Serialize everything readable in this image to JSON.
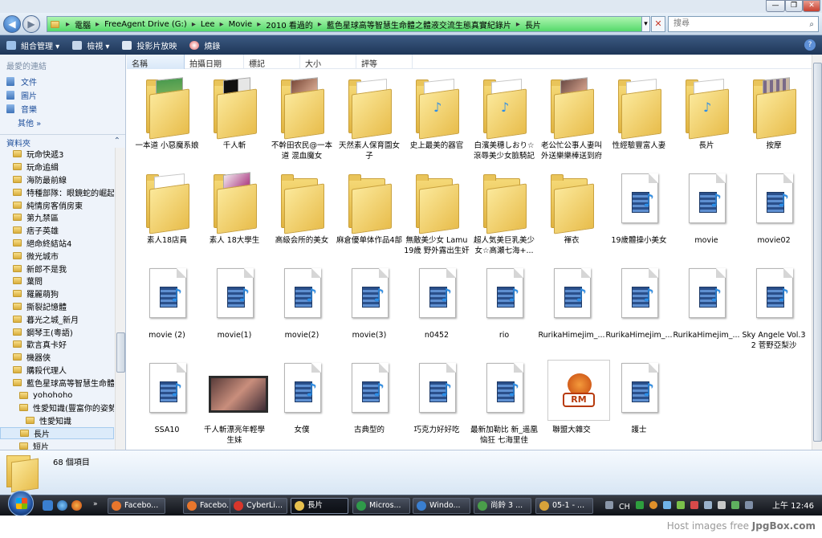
{
  "window": {
    "minimize": "—",
    "maximize": "❐",
    "close": "✕"
  },
  "address": {
    "segments": [
      "電腦",
      "FreeAgent Drive (G:)",
      "Lee",
      "Movie",
      "2010 看過的",
      "藍色星球高等智慧生命體之體液交流生態真實紀錄片",
      "長片"
    ],
    "separator": "▸",
    "dropdown": "▾",
    "stop": "✕",
    "search_placeholder": "搜尋"
  },
  "nav": {
    "back": "◀",
    "forward": "▶"
  },
  "toolbar": {
    "organize": "組合管理 ▾",
    "views": "檢視 ▾",
    "slideshow": "投影片放映",
    "burn": "燒錄",
    "help": "?"
  },
  "favorites": {
    "header": "最愛的連結",
    "items": [
      "文件",
      "圖片",
      "音樂"
    ],
    "more": "其他  »"
  },
  "folders_header": "資料夾",
  "folders_chevron": "⌃",
  "tree": [
    {
      "label": "玩命快遞3",
      "indent": 0
    },
    {
      "label": "玩命追緝",
      "indent": 0
    },
    {
      "label": "海防最前線",
      "indent": 0
    },
    {
      "label": "特種部隊：眼鏡蛇的崛起",
      "indent": 0
    },
    {
      "label": "純情房客俏房東",
      "indent": 0
    },
    {
      "label": "第九禁區",
      "indent": 0
    },
    {
      "label": "痞子英雄",
      "indent": 0
    },
    {
      "label": "絕命終結站4",
      "indent": 0
    },
    {
      "label": "微光城市",
      "indent": 0
    },
    {
      "label": "新郎不是我",
      "indent": 0
    },
    {
      "label": "葉問",
      "indent": 0
    },
    {
      "label": "羅麗萌狗",
      "indent": 0
    },
    {
      "label": "撕裂記憶體",
      "indent": 0
    },
    {
      "label": "暮光之城_新月",
      "indent": 0
    },
    {
      "label": "鋼琴王(粵語)",
      "indent": 0
    },
    {
      "label": "歡言真卡好",
      "indent": 0
    },
    {
      "label": "機器俠",
      "indent": 0
    },
    {
      "label": "購殺代理人",
      "indent": 0
    },
    {
      "label": "藍色星球高等智慧生命體之",
      "indent": 0
    },
    {
      "label": "yohohoho",
      "indent": 1
    },
    {
      "label": "性愛知識(豐富你的姿勢)",
      "indent": 1
    },
    {
      "label": "性愛知識",
      "indent": 2
    },
    {
      "label": "長片",
      "indent": 1,
      "selected": true
    },
    {
      "label": "短片",
      "indent": 1
    }
  ],
  "columns": [
    "名稱",
    "拍攝日期",
    "標記",
    "大小",
    "評等"
  ],
  "items": [
    {
      "name": "一本道 小惡魔系娘",
      "type": "folder",
      "variant": "green"
    },
    {
      "name": "千人斬",
      "type": "folder",
      "variant": "dark"
    },
    {
      "name": "不幹田农民@一本道 混血魔女",
      "type": "folder",
      "variant": "photo"
    },
    {
      "name": "天然素人保育園女子",
      "type": "folder",
      "variant": "paper"
    },
    {
      "name": "史上最美的器官",
      "type": "folder",
      "variant": "media"
    },
    {
      "name": "白濱美穗しおり☆滾辱美少女臉騎記",
      "type": "folder",
      "variant": "media"
    },
    {
      "name": "老公忙公事人妻叫外送樂樂棒送到府",
      "type": "folder",
      "variant": "photo2"
    },
    {
      "name": "性經驗豐富人妻",
      "type": "folder",
      "variant": "paper"
    },
    {
      "name": "長片",
      "type": "folder",
      "variant": "media"
    },
    {
      "name": "按摩",
      "type": "folder",
      "variant": "grid"
    },
    {
      "name": "素人18店員",
      "type": "folder",
      "variant": "paper"
    },
    {
      "name": "素人 18大學生",
      "type": "folder",
      "variant": "photo3"
    },
    {
      "name": "高級会所的美女",
      "type": "folder",
      "variant": "plain"
    },
    {
      "name": "麻倉優单体作品4部",
      "type": "folder",
      "variant": "plain"
    },
    {
      "name": "無敵美少女 Lamu 19歳 野外露出生奸",
      "type": "folder",
      "variant": "plain"
    },
    {
      "name": "超人気美巨乳美少女☆高瀬七海+...",
      "type": "folder",
      "variant": "plain"
    },
    {
      "name": "褌衣",
      "type": "folder",
      "variant": "plain"
    },
    {
      "name": "19歲體操小美女",
      "type": "media"
    },
    {
      "name": "movie",
      "type": "media"
    },
    {
      "name": "movie02",
      "type": "media"
    },
    {
      "name": "movie (2)",
      "type": "media"
    },
    {
      "name": "movie(1)",
      "type": "media"
    },
    {
      "name": "movie(2)",
      "type": "media"
    },
    {
      "name": "movie(3)",
      "type": "media"
    },
    {
      "name": "n0452",
      "type": "media"
    },
    {
      "name": "rio",
      "type": "media"
    },
    {
      "name": "RurikaHimejim_...",
      "type": "media"
    },
    {
      "name": "RurikaHimejim_...",
      "type": "media"
    },
    {
      "name": "RurikaHimejim_...",
      "type": "media"
    },
    {
      "name": "Sky Angele Vol.32 菅野亞梨沙",
      "type": "media"
    },
    {
      "name": "SSA10",
      "type": "media"
    },
    {
      "name": "千人斬漂亮年輕學生妹",
      "type": "video"
    },
    {
      "name": "女僕",
      "type": "media"
    },
    {
      "name": "古典型的",
      "type": "media"
    },
    {
      "name": "巧克力好好吃",
      "type": "media"
    },
    {
      "name": "最新加勒比 新_遥凰恼狂 七海里佳",
      "type": "media"
    },
    {
      "name": "聯盟大雜交",
      "type": "rm"
    },
    {
      "name": "護士",
      "type": "media"
    }
  ],
  "status": {
    "count": "68 個項目"
  },
  "taskbar": {
    "buttons": [
      {
        "label": "Facebo...",
        "color": "#e8762c"
      },
      {
        "label": "Facebo...",
        "color": "#e8762c"
      },
      {
        "label": "CyberLi...",
        "color": "#d9362b"
      },
      {
        "label": "長片",
        "color": "#e6c04e",
        "active": true
      },
      {
        "label": "Micros...",
        "color": "#2f9a4a"
      },
      {
        "label": "Windo...",
        "color": "#3a7fd0"
      },
      {
        "label": "尚鈴 3 ...",
        "color": "#4a9e4a"
      },
      {
        "label": "05-1 - ...",
        "color": "#d8a33a"
      }
    ],
    "clock": "上午 12:46",
    "tray_lang": "CH"
  },
  "footer": {
    "prefix": "Host images free ",
    "brand": "JpgBox.com"
  }
}
